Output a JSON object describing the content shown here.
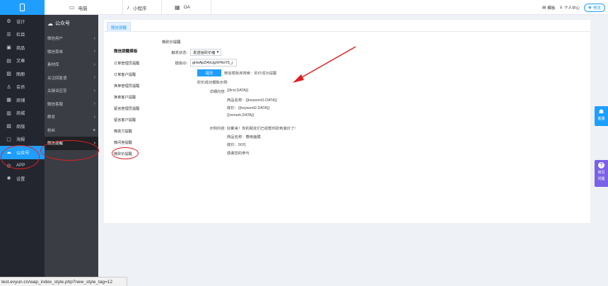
{
  "topbar": {
    "tabs": [
      {
        "icon": "monitor-icon",
        "label": "电脑"
      },
      {
        "icon": "miniprogram-icon",
        "label": "小程序"
      },
      {
        "icon": "calendar-icon",
        "label": "OA"
      }
    ],
    "right": {
      "template": "模板",
      "user_center": "个人中心",
      "preview": "预览"
    }
  },
  "leftnav": [
    {
      "icon": "gear-icon",
      "label": "设计"
    },
    {
      "icon": "list-icon",
      "label": "栏目"
    },
    {
      "icon": "goods-icon",
      "label": "商品"
    },
    {
      "icon": "article-icon",
      "label": "文章"
    },
    {
      "icon": "gallery-icon",
      "label": "图册"
    },
    {
      "icon": "user-icon",
      "label": "会员"
    },
    {
      "icon": "store-icon",
      "label": "商铺"
    },
    {
      "icon": "mall-icon",
      "label": "商城"
    },
    {
      "icon": "layout-icon",
      "label": "商版"
    },
    {
      "icon": "box-icon",
      "label": "海报"
    },
    {
      "icon": "wechat-icon",
      "label": "公众号"
    },
    {
      "icon": "app-icon",
      "label": "APP"
    },
    {
      "icon": "settings-icon",
      "label": "设置"
    }
  ],
  "subnav": {
    "title": "公众号",
    "items": [
      {
        "label": "微信用户"
      },
      {
        "label": "微信菜单"
      },
      {
        "label": "素材库"
      },
      {
        "label": "关注回复语"
      },
      {
        "label": "关键词应答"
      },
      {
        "label": "微信客服"
      },
      {
        "label": "群发"
      },
      {
        "label": "粉丝"
      },
      {
        "label": "微信提醒"
      }
    ]
  },
  "card": {
    "tab": "微信提醒",
    "template_list": {
      "title": "微信提醒模板",
      "items": [
        "订单管理员提醒",
        "订单客户提醒",
        "换单管理员提醒",
        "换单客户提醒",
        "留言管理员提醒",
        "留言客户提醒",
        "微助力提醒",
        "微问答提醒",
        "微砍价提醒"
      ]
    },
    "form": {
      "section": "微砍价提醒",
      "trigger_label": "触发状态:",
      "trigger_value": "发送给砍价者",
      "template_id_label": "模板ID:",
      "template_id_value": "gHoApZl4xUgXFNvY5_j",
      "submit": "提交",
      "search_hint": "微信模板库搜索：砍价成功提醒",
      "example_title": "砍价成功模板示例:",
      "detail_label": "详细内容:",
      "detail_lines": [
        "{{first.DATA}}",
        "商品名称：{{keyword1.DATA}}",
        "底价：{{keyword2.DATA}}",
        "{{remark.DATA}}"
      ],
      "sample_label": "示例内容:",
      "sample_lines": [
        "好聚来！你的朋友们已经帮你砍到底价了!",
        "商品名称：春雨面膜",
        "底价：50元",
        "感谢您的参与"
      ]
    }
  },
  "floats": {
    "help": "客服",
    "faq_line1": "常见",
    "faq_line2": "问题"
  },
  "statusbar": "test.evyun.cn/wap_index_style.php?new_style_tag=12",
  "colors": {
    "accent": "#1e9fff",
    "nav_dark": "#23262e",
    "subnav": "#3a3d44",
    "annotation": "#e02020",
    "faq": "#7a62e6"
  }
}
